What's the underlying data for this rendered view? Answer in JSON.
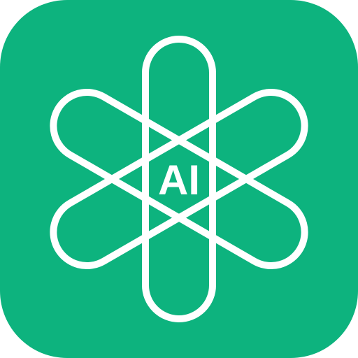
{
  "app_icon": {
    "name": "ai-app-icon",
    "label": "AI",
    "colors": {
      "background": "#0db37e",
      "foreground": "#ffffff"
    },
    "icons": {
      "emblem": "six-petal-knot-icon"
    }
  }
}
